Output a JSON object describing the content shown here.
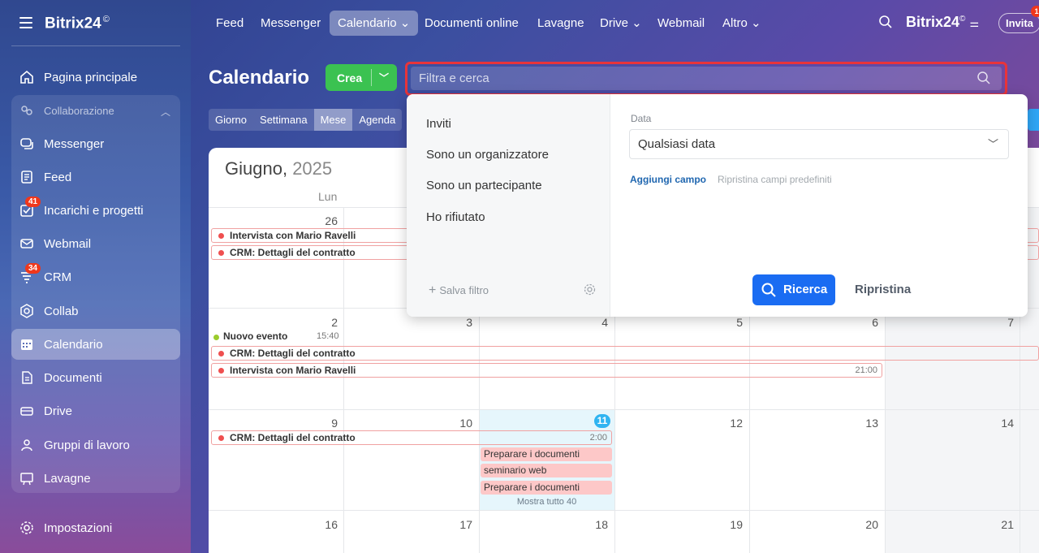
{
  "brand": {
    "name": "Bitrix24",
    "mark": "©"
  },
  "sidebar": {
    "group_label": "Collaborazione",
    "items": [
      {
        "label": "Pagina principale"
      },
      {
        "label": "Messenger"
      },
      {
        "label": "Feed"
      },
      {
        "label": "Incarichi e progetti",
        "badge": "41"
      },
      {
        "label": "Webmail"
      },
      {
        "label": "CRM",
        "badge": "34"
      },
      {
        "label": "Collab"
      },
      {
        "label": "Calendario"
      },
      {
        "label": "Documenti"
      },
      {
        "label": "Drive"
      },
      {
        "label": "Gruppi di lavoro"
      },
      {
        "label": "Lavagne"
      },
      {
        "label": "Impostazioni"
      }
    ]
  },
  "topnav": {
    "items": [
      {
        "label": "Feed"
      },
      {
        "label": "Messenger"
      },
      {
        "label": "Calendario ⌄"
      },
      {
        "label": "Documenti online"
      },
      {
        "label": "Lavagne"
      },
      {
        "label": "Drive ⌄"
      },
      {
        "label": "Webmail"
      },
      {
        "label": "Altro ⌄"
      }
    ],
    "invite_label": "Invita",
    "invite_badge": "1"
  },
  "header": {
    "title": "Calendario",
    "create_label": "Crea",
    "search_placeholder": "Filtra e cerca"
  },
  "views": [
    "Giorno",
    "Settimana",
    "Mese",
    "Agenda"
  ],
  "calendar": {
    "month": "Giugno,",
    "year": "2025",
    "dow_first": "Lun",
    "day_numbers": [
      "26",
      "2",
      "3",
      "4",
      "5",
      "6",
      "7",
      "9",
      "10",
      "11",
      "12",
      "13",
      "14",
      "16",
      "17",
      "18",
      "19",
      "20",
      "21"
    ],
    "events": {
      "intervista": "Intervista con Mario Ravelli",
      "crm": "CRM: Dettagli del contratto",
      "nuovo": "Nuovo evento",
      "nuovo_time": "15:40",
      "intervista_time": "21:00",
      "crm_time": "2:00",
      "prep1": "Preparare i documenti",
      "seminario": "seminario web",
      "prep2": "Preparare i documenti",
      "more": "Mostra tutto 40"
    }
  },
  "filter_popup": {
    "presets": [
      "Inviti",
      "Sono un organizzatore",
      "Sono un partecipante",
      "Ho rifiutato"
    ],
    "save_filter": "Salva filtro",
    "field_label": "Data",
    "field_value": "Qualsiasi data",
    "add_field": "Aggiungi campo",
    "reset_fields": "Ripristina campi predefiniti",
    "search_button": "Ricerca",
    "reset_button": "Ripristina"
  }
}
